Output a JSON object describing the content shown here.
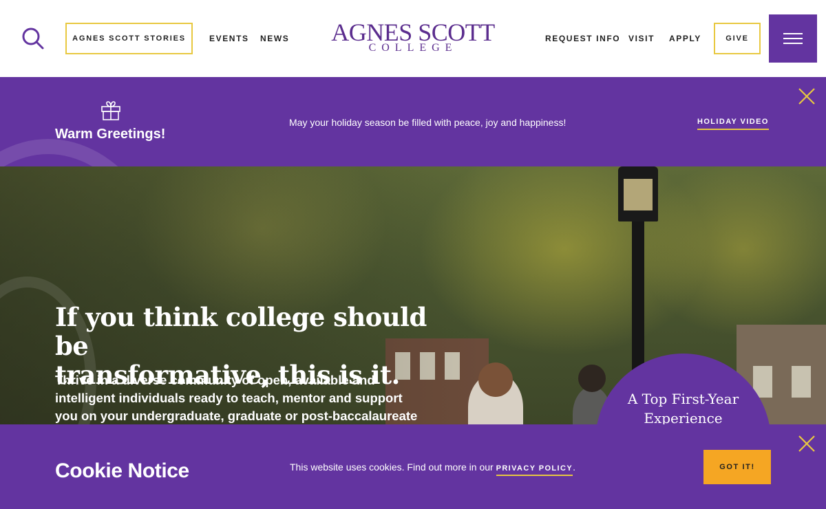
{
  "header": {
    "logo_main": "AGNES SCOTT",
    "logo_sub": "COLLEGE",
    "stories_label": "AGNES SCOTT STORIES",
    "events_label": "EVENTS",
    "news_label": "NEWS",
    "request_info_label": "REQUEST INFO",
    "visit_label": "VISIT",
    "apply_label": "APPLY",
    "give_label": "GIVE",
    "icons": [
      "search-icon",
      "hamburger-menu-icon"
    ]
  },
  "holiday": {
    "title": "Warm Greetings!",
    "message": "May your holiday season be filled with peace, joy and happiness!",
    "link_label": "HOLIDAY VIDEO",
    "icons": [
      "gift-icon",
      "close-icon"
    ]
  },
  "hero": {
    "headline_line1": "If you think college should be",
    "headline_line2": "transformative, this is it.",
    "body_line1": "Thrive in a diverse community of open, available and",
    "body_line2": "intelligent individuals ready to teach, mentor and support",
    "body_line3": "you on your undergraduate, graduate or post-baccalaureate",
    "badge_line1": "A Top First-Year",
    "badge_line2": "Experience"
  },
  "cookie": {
    "title": "Cookie Notice",
    "text": "This website uses cookies.  Find out more in our ",
    "link_label": "PRIVACY POLICY",
    "period": ".",
    "button_label": "GOT IT!"
  },
  "colors": {
    "brand_purple": "#6334a0",
    "accent_yellow": "#e8c840",
    "button_orange": "#f5a623"
  }
}
